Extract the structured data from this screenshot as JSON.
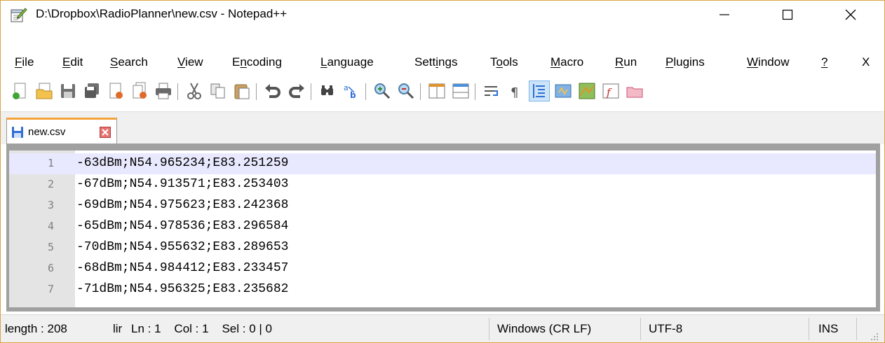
{
  "window": {
    "title": "D:\\Dropbox\\RadioPlanner\\new.csv - Notepad++",
    "min_glyph": "—",
    "max_glyph": "☐",
    "close_glyph": "✕"
  },
  "menu": [
    {
      "label": "File"
    },
    {
      "label": "Edit"
    },
    {
      "label": "Search"
    },
    {
      "label": "View"
    },
    {
      "label": "Encoding"
    },
    {
      "label": "Language"
    },
    {
      "label": "Settings"
    },
    {
      "label": "Tools"
    },
    {
      "label": "Macro"
    },
    {
      "label": "Run"
    },
    {
      "label": "Plugins"
    },
    {
      "label": "Window"
    },
    {
      "label": "?"
    },
    {
      "label": "X"
    }
  ],
  "toolbar": {
    "icons": [
      "new-file-icon",
      "open-file-icon",
      "save-icon",
      "save-all-icon",
      "close-icon",
      "close-all-icon",
      "print-icon",
      "cut-icon",
      "copy-icon",
      "paste-icon",
      "undo-icon",
      "redo-icon",
      "find-icon",
      "replace-icon",
      "zoom-in-icon",
      "zoom-out-icon",
      "sync-vertical-icon",
      "sync-horizontal-icon",
      "word-wrap-icon",
      "show-all-chars-icon",
      "indent-guide-icon",
      "user-defined-language-icon",
      "document-map-icon",
      "function-list-icon",
      "folder-as-workspace-icon"
    ]
  },
  "tabs": [
    {
      "label": "new.csv",
      "close_glyph": "✖"
    }
  ],
  "editor": {
    "lines": [
      {
        "num": "1",
        "text": "-63dBm;N54.965234;E83.251259"
      },
      {
        "num": "2",
        "text": "-67dBm;N54.913571;E83.253403"
      },
      {
        "num": "3",
        "text": "-69dBm;N54.975623;E83.242368"
      },
      {
        "num": "4",
        "text": "-65dBm;N54.978536;E83.296584"
      },
      {
        "num": "5",
        "text": "-70dBm;N54.955632;E83.289653"
      },
      {
        "num": "6",
        "text": "-68dBm;N54.984412;E83.233457"
      },
      {
        "num": "7",
        "text": "-71dBm;N54.956325;E83.235682"
      }
    ],
    "current_line_color": "#e8e8ff"
  },
  "status": {
    "length": "length : 208",
    "lines_cut": "lir",
    "position": "Ln : 1    Col : 1    Sel : 0 | 0",
    "eol": "Windows (CR LF)",
    "encoding": "UTF-8",
    "mode": "INS"
  },
  "colors": {
    "window_border": "#d9a441",
    "tab_accent": "#f6a33b",
    "save_blue": "#2f6fd6"
  }
}
